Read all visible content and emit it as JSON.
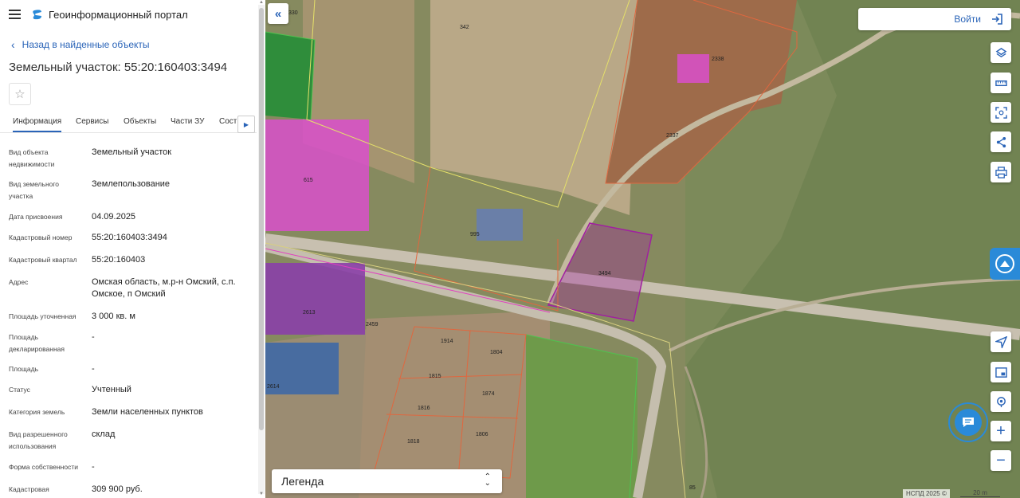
{
  "app": {
    "title": "Геоинформационный портал"
  },
  "nav": {
    "back_label": "Назад в найденные объекты"
  },
  "page": {
    "title": "Земельный участок: 55:20:160403:3494"
  },
  "tabs": [
    {
      "label": "Информация",
      "active": true
    },
    {
      "label": "Сервисы"
    },
    {
      "label": "Объекты"
    },
    {
      "label": "Части ЗУ"
    },
    {
      "label": "Состав"
    }
  ],
  "properties": [
    {
      "label": "Вид объекта недвижимости",
      "value": "Земельный участок"
    },
    {
      "label": "Вид земельного участка",
      "value": "Землепользование"
    },
    {
      "label": "Дата присвоения",
      "value": "04.09.2025"
    },
    {
      "label": "Кадастровый номер",
      "value": "55:20:160403:3494"
    },
    {
      "label": "Кадастровый квартал",
      "value": "55:20:160403"
    },
    {
      "label": "Адрес",
      "value": "Омская область, м.р-н Омский, с.п. Омское, п Омский"
    },
    {
      "label": "Площадь уточненная",
      "value": "3 000 кв. м"
    },
    {
      "label": "Площадь декларированная",
      "value": "-"
    },
    {
      "label": "Площадь",
      "value": "-"
    },
    {
      "label": "Статус",
      "value": "Учтенный"
    },
    {
      "label": "Категория земель",
      "value": "Земли населенных пунктов"
    },
    {
      "label": "Вид разрешенного использования",
      "value": "склад"
    },
    {
      "label": "Форма собственности",
      "value": "-"
    },
    {
      "label": "Кадастровая",
      "value": "309 900 руб."
    }
  ],
  "map": {
    "login_label": "Войти",
    "legend_label": "Легенда",
    "copyright": "НСПД 2025 ©",
    "scale_label": "20 m",
    "parcel_labels": [
      "330",
      "342",
      "2338",
      "2337",
      "615",
      "995",
      "3494",
      "2613",
      "2459",
      "1914",
      "1804",
      "1815",
      "1874",
      "1816",
      "1806",
      "1818",
      "2614",
      "85"
    ],
    "highlight_color": "#a020a0",
    "accent_color": "#2a64b8"
  }
}
